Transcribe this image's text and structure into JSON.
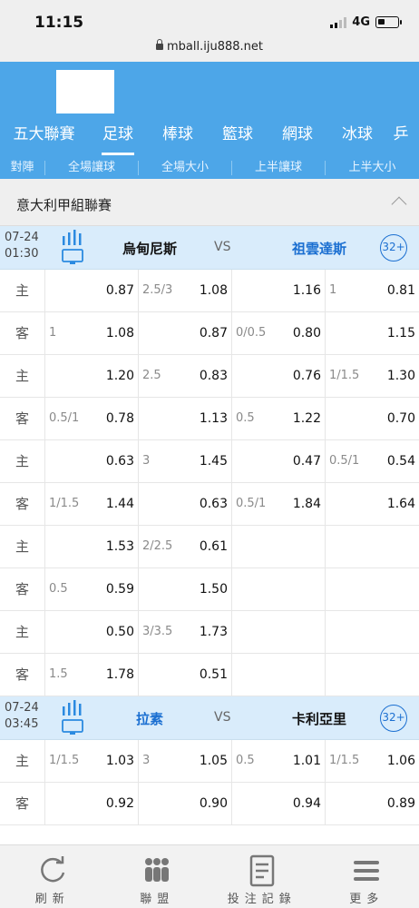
{
  "status": {
    "time": "11:15",
    "network": "4G"
  },
  "url": "mball.iju888.net",
  "nav": {
    "tabs": [
      "五大聯賽",
      "足球",
      "棒球",
      "籃球",
      "網球",
      "冰球",
      "乒"
    ],
    "active_index": 1
  },
  "subtabs": [
    "對陣",
    "全場讓球",
    "全場大小",
    "上半讓球",
    "上半大小"
  ],
  "league": {
    "name": "意大利甲組聯賽"
  },
  "matches": [
    {
      "date": "07-24",
      "time": "01:30",
      "home": "烏甸尼斯",
      "vs": "VS",
      "away": "祖雲達斯",
      "more": "32+",
      "rows": [
        {
          "side": "主",
          "c1": [
            "",
            "0.87"
          ],
          "c2": [
            "2.5/3",
            "1.08"
          ],
          "c3": [
            "",
            "1.16"
          ],
          "c4": [
            "1",
            "0.81"
          ]
        },
        {
          "side": "客",
          "c1": [
            "1",
            "1.08"
          ],
          "c2": [
            "",
            "0.87"
          ],
          "c3": [
            "0/0.5",
            "0.80"
          ],
          "c4": [
            "",
            "1.15"
          ]
        },
        {
          "side": "主",
          "c1": [
            "",
            "1.20"
          ],
          "c2": [
            "2.5",
            "0.83"
          ],
          "c3": [
            "",
            "0.76"
          ],
          "c4": [
            "1/1.5",
            "1.30"
          ]
        },
        {
          "side": "客",
          "c1": [
            "0.5/1",
            "0.78"
          ],
          "c2": [
            "",
            "1.13"
          ],
          "c3": [
            "0.5",
            "1.22"
          ],
          "c4": [
            "",
            "0.70"
          ]
        },
        {
          "side": "主",
          "c1": [
            "",
            "0.63"
          ],
          "c2": [
            "3",
            "1.45"
          ],
          "c3": [
            "",
            "0.47"
          ],
          "c4": [
            "0.5/1",
            "0.54"
          ]
        },
        {
          "side": "客",
          "c1": [
            "1/1.5",
            "1.44"
          ],
          "c2": [
            "",
            "0.63"
          ],
          "c3": [
            "0.5/1",
            "1.84"
          ],
          "c4": [
            "",
            "1.64"
          ]
        },
        {
          "side": "主",
          "c1": [
            "",
            "1.53"
          ],
          "c2": [
            "2/2.5",
            "0.61"
          ],
          "c3": [
            "",
            ""
          ],
          "c4": [
            "",
            ""
          ]
        },
        {
          "side": "客",
          "c1": [
            "0.5",
            "0.59"
          ],
          "c2": [
            "",
            "1.50"
          ],
          "c3": [
            "",
            ""
          ],
          "c4": [
            "",
            ""
          ]
        },
        {
          "side": "主",
          "c1": [
            "",
            "0.50"
          ],
          "c2": [
            "3/3.5",
            "1.73"
          ],
          "c3": [
            "",
            ""
          ],
          "c4": [
            "",
            ""
          ]
        },
        {
          "side": "客",
          "c1": [
            "1.5",
            "1.78"
          ],
          "c2": [
            "",
            "0.51"
          ],
          "c3": [
            "",
            ""
          ],
          "c4": [
            "",
            ""
          ]
        }
      ]
    },
    {
      "date": "07-24",
      "time": "03:45",
      "home": "拉素",
      "vs": "VS",
      "away": "卡利亞里",
      "more": "32+",
      "rows": [
        {
          "side": "主",
          "c1": [
            "1/1.5",
            "1.03"
          ],
          "c2": [
            "3",
            "1.05"
          ],
          "c3": [
            "0.5",
            "1.01"
          ],
          "c4": [
            "1/1.5",
            "1.06"
          ]
        },
        {
          "side": "客",
          "c1": [
            "",
            "0.92"
          ],
          "c2": [
            "",
            "0.90"
          ],
          "c3": [
            "",
            "0.94"
          ],
          "c4": [
            "",
            "0.89"
          ]
        }
      ]
    }
  ],
  "bottom_nav": [
    "刷新",
    "聯盟",
    "投注記錄",
    "更多"
  ],
  "colors": {
    "header_blue": "#4da6e8",
    "match_bg": "#d9ecfb",
    "accent_blue": "#1b6fd1"
  }
}
